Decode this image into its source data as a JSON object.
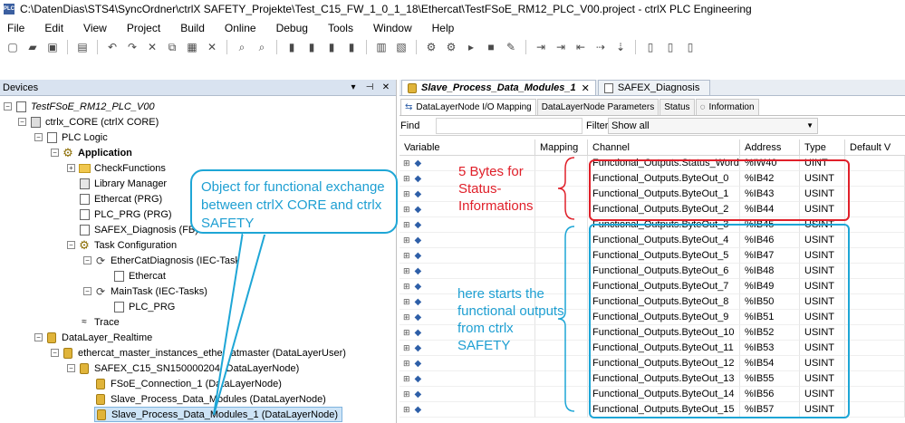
{
  "window": {
    "title": "C:\\DatenDias\\STS4\\SyncOrdner\\ctrlX SAFETY_Projekte\\Test_C15_FW_1_0_1_18\\Ethercat\\TestFSoE_RM12_PLC_V00.project - ctrlX PLC Engineering",
    "app_icon_label": "PLC"
  },
  "menu": [
    "File",
    "Edit",
    "View",
    "Project",
    "Build",
    "Online",
    "Debug",
    "Tools",
    "Window",
    "Help"
  ],
  "devices_panel": {
    "title": "Devices",
    "header_buttons": [
      "▾",
      "⊣",
      "✕"
    ],
    "tree": [
      {
        "label": "TestFSoE_RM12_PLC_V00",
        "expander": "−"
      },
      {
        "label": "ctrlx_CORE (ctrlX CORE)",
        "expander": "−"
      },
      {
        "label": "PLC Logic",
        "expander": "−"
      },
      {
        "label": "Application",
        "expander": "−"
      },
      {
        "label": "CheckFunctions",
        "expander": "+"
      },
      {
        "label": "Library Manager",
        "expander": ""
      },
      {
        "label": "Ethercat (PRG)",
        "expander": ""
      },
      {
        "label": "PLC_PRG (PRG)",
        "expander": ""
      },
      {
        "label": "SAFEX_Diagnosis (FB)",
        "expander": ""
      },
      {
        "label": "Task Configuration",
        "expander": "−"
      },
      {
        "label": "EtherCatDiagnosis (IEC-Tasks)",
        "expander": "−"
      },
      {
        "label": "Ethercat",
        "expander": ""
      },
      {
        "label": "MainTask (IEC-Tasks)",
        "expander": "−"
      },
      {
        "label": "PLC_PRG",
        "expander": ""
      },
      {
        "label": "Trace",
        "expander": ""
      },
      {
        "label": "DataLayer_Realtime",
        "expander": "−"
      },
      {
        "label": "ethercat_master_instances_ethercatmaster (DataLayerUser)",
        "expander": "−"
      },
      {
        "label": "SAFEX_C15_SN150000204 (DataLayerNode)",
        "expander": "−"
      },
      {
        "label": "FSoE_Connection_1 (DataLayerNode)",
        "expander": ""
      },
      {
        "label": "Slave_Process_Data_Modules (DataLayerNode)",
        "expander": ""
      },
      {
        "label": "Slave_Process_Data_Modules_1 (DataLayerNode)",
        "expander": ""
      }
    ]
  },
  "editor": {
    "tabs": [
      {
        "label": "Slave_Process_Data_Modules_1",
        "close": "✕"
      },
      {
        "label": "SAFEX_Diagnosis"
      }
    ],
    "sub_tabs": [
      "DataLayerNode I/O Mapping",
      "DataLayerNode Parameters",
      "Status",
      "Information"
    ],
    "find_label": "Find",
    "filter_label": "Filter",
    "filter_value": "Show all",
    "columns": [
      "Variable",
      "Mapping",
      "Channel",
      "Address",
      "Type",
      "Default V"
    ],
    "rows": [
      {
        "channel": "Functional_Outputs.Status_Word",
        "address": "%IW40",
        "type": "UINT"
      },
      {
        "channel": "Functional_Outputs.ByteOut_0",
        "address": "%IB42",
        "type": "USINT"
      },
      {
        "channel": "Functional_Outputs.ByteOut_1",
        "address": "%IB43",
        "type": "USINT"
      },
      {
        "channel": "Functional_Outputs.ByteOut_2",
        "address": "%IB44",
        "type": "USINT"
      },
      {
        "channel": "Functional_Outputs.ByteOut_3",
        "address": "%IB45",
        "type": "USINT"
      },
      {
        "channel": "Functional_Outputs.ByteOut_4",
        "address": "%IB46",
        "type": "USINT"
      },
      {
        "channel": "Functional_Outputs.ByteOut_5",
        "address": "%IB47",
        "type": "USINT"
      },
      {
        "channel": "Functional_Outputs.ByteOut_6",
        "address": "%IB48",
        "type": "USINT"
      },
      {
        "channel": "Functional_Outputs.ByteOut_7",
        "address": "%IB49",
        "type": "USINT"
      },
      {
        "channel": "Functional_Outputs.ByteOut_8",
        "address": "%IB50",
        "type": "USINT"
      },
      {
        "channel": "Functional_Outputs.ByteOut_9",
        "address": "%IB51",
        "type": "USINT"
      },
      {
        "channel": "Functional_Outputs.ByteOut_10",
        "address": "%IB52",
        "type": "USINT"
      },
      {
        "channel": "Functional_Outputs.ByteOut_11",
        "address": "%IB53",
        "type": "USINT"
      },
      {
        "channel": "Functional_Outputs.ByteOut_12",
        "address": "%IB54",
        "type": "USINT"
      },
      {
        "channel": "Functional_Outputs.ByteOut_13",
        "address": "%IB55",
        "type": "USINT"
      },
      {
        "channel": "Functional_Outputs.ByteOut_14",
        "address": "%IB56",
        "type": "USINT"
      },
      {
        "channel": "Functional_Outputs.ByteOut_15",
        "address": "%IB57",
        "type": "USINT"
      }
    ]
  },
  "annotations": {
    "callout_text": "Object for functional exchange between ctrlX CORE and ctrlx SAFETY",
    "status_note": "5 Bytes for Status-Informations",
    "outputs_note": "here starts the functional outputs from ctrlx SAFETY",
    "red_color": "#e0202a",
    "blue_color": "#1ea6d6"
  }
}
